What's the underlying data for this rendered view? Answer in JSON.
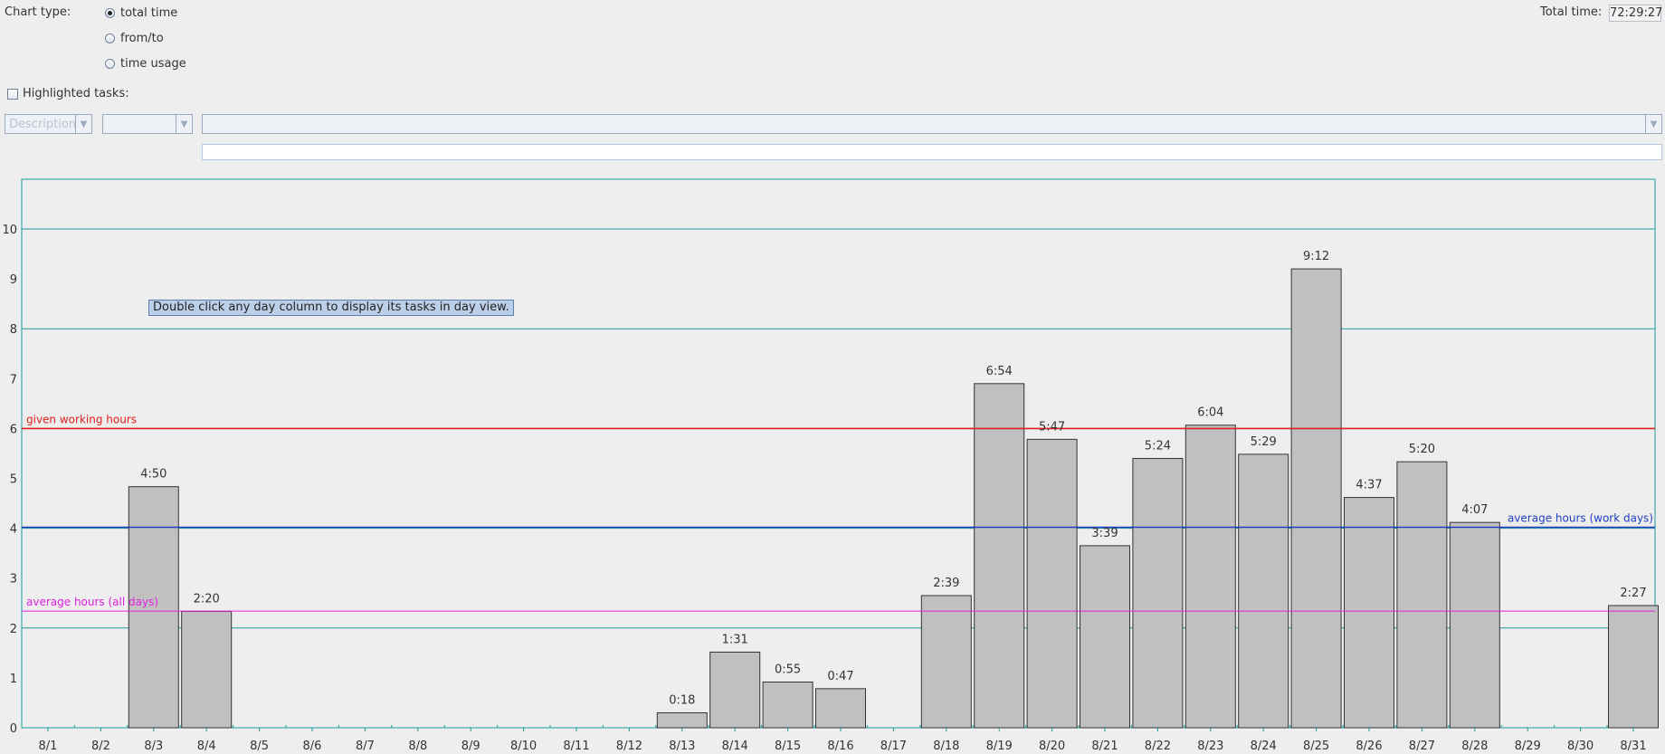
{
  "header": {
    "chart_type_label": "Chart type:",
    "chart_types": [
      {
        "label": "total time",
        "checked": true
      },
      {
        "label": "from/to",
        "checked": false
      },
      {
        "label": "time usage",
        "checked": false
      }
    ],
    "total_time_label": "Total time:",
    "total_time_value": "72:29:27"
  },
  "filter": {
    "highlighted_label": "Highlighted tasks:",
    "field_combo_value": "Description",
    "operator_combo_value": "",
    "value_combo_value": "",
    "text_value": ""
  },
  "tooltip": "Double click any day column to display its tasks in day view.",
  "colors": {
    "grid": "#1c9a9a",
    "given": "#e02020",
    "avg_work": "#1f3fc0",
    "avg_all": "#e020e0",
    "bar_fill": "#c0c0c0",
    "bar_stroke": "#333333"
  },
  "chart_data": {
    "type": "bar",
    "categories": [
      "8/1",
      "8/2",
      "8/3",
      "8/4",
      "8/5",
      "8/6",
      "8/7",
      "8/8",
      "8/9",
      "8/10",
      "8/11",
      "8/12",
      "8/13",
      "8/14",
      "8/15",
      "8/16",
      "8/17",
      "8/18",
      "8/19",
      "8/20",
      "8/21",
      "8/22",
      "8/23",
      "8/24",
      "8/25",
      "8/26",
      "8/27",
      "8/28",
      "8/29",
      "8/30",
      "8/31"
    ],
    "values": [
      0,
      0,
      4.8333,
      2.3333,
      0,
      0,
      0,
      0,
      0,
      0,
      0,
      0,
      0.3,
      1.5167,
      0.9167,
      0.7833,
      0,
      2.65,
      6.9,
      5.7833,
      3.65,
      5.4,
      6.0667,
      5.4833,
      9.2,
      4.6167,
      5.3333,
      4.1167,
      0,
      0,
      2.45
    ],
    "labels": [
      "",
      "",
      "4:50",
      "2:20",
      "",
      "",
      "",
      "",
      "",
      "",
      "",
      "",
      "0:18",
      "1:31",
      "0:55",
      "0:47",
      "",
      "2:39",
      "6:54",
      "5:47",
      "3:39",
      "5:24",
      "6:04",
      "5:29",
      "9:12",
      "4:37",
      "5:20",
      "4:07",
      "",
      "",
      "2:27"
    ],
    "ylim": [
      0,
      11
    ],
    "yticks": [
      0,
      1,
      2,
      3,
      4,
      5,
      6,
      7,
      8,
      9,
      10
    ],
    "grid_y": [
      2,
      4,
      6,
      8,
      10
    ],
    "reference_lines": [
      {
        "name": "given working hours",
        "value": 6,
        "color": "#e02020",
        "label_side": "left"
      },
      {
        "name": "average hours (work days)",
        "value": 4.02,
        "color": "#1f3fc0",
        "label_side": "right"
      },
      {
        "name": "average hours (all days)",
        "value": 2.34,
        "color": "#e020e0",
        "label_side": "left"
      }
    ]
  }
}
